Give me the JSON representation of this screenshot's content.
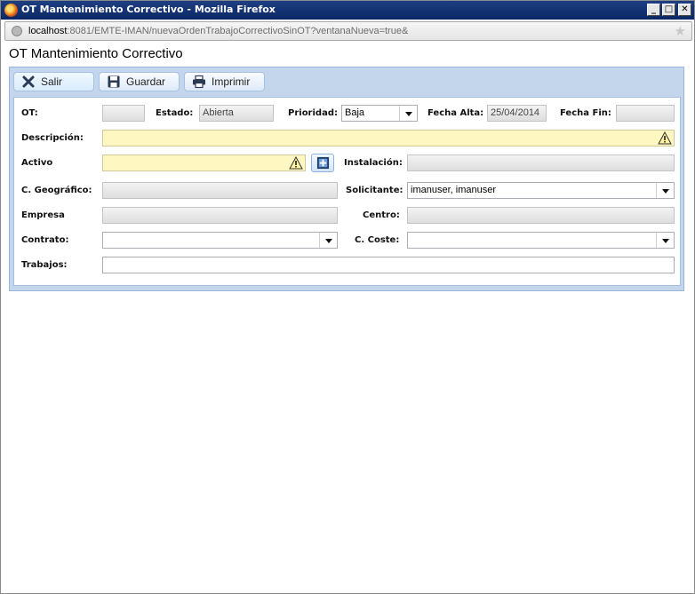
{
  "window": {
    "title": "OT Mantenimiento Correctivo - Mozilla Firefox",
    "buttons": {
      "minimize": "_",
      "maximize": "□",
      "close": "✕"
    }
  },
  "address": {
    "host": "localhost",
    "rest": ":8081/EMTE-IMAN/nuevaOrdenTrabajoCorrectivoSinOT?ventanaNueva=true&"
  },
  "page": {
    "title": "OT Mantenimiento Correctivo"
  },
  "toolbar": {
    "salir": "Salir",
    "guardar": "Guardar",
    "imprimir": "Imprimir"
  },
  "form": {
    "ot": {
      "label": "OT:",
      "value": ""
    },
    "estado": {
      "label": "Estado:",
      "value": "Abierta"
    },
    "prioridad": {
      "label": "Prioridad:",
      "value": "Baja"
    },
    "fecha_alta": {
      "label": "Fecha Alta:",
      "value": "25/04/2014"
    },
    "fecha_fin": {
      "label": "Fecha Fin:",
      "value": ""
    },
    "descripcion": {
      "label": "Descripción:",
      "value": ""
    },
    "activo": {
      "label": "Activo",
      "value": ""
    },
    "instalacion": {
      "label": "Instalación:",
      "value": ""
    },
    "c_geografico": {
      "label": "C. Geográfico:",
      "value": ""
    },
    "solicitante": {
      "label": "Solicitante:",
      "value": "imanuser, imanuser"
    },
    "empresa": {
      "label": "Empresa",
      "value": ""
    },
    "centro": {
      "label": "Centro:",
      "value": ""
    },
    "contrato": {
      "label": "Contrato:",
      "value": ""
    },
    "c_coste": {
      "label": "C. Coste:",
      "value": ""
    },
    "trabajos": {
      "label": "Trabajos:",
      "value": ""
    }
  },
  "icons": {
    "salir": "close-x-icon",
    "guardar": "floppy-disk-icon",
    "imprimir": "printer-icon",
    "warning": "warning-triangle-icon",
    "add": "add-item-icon",
    "bookmark": "star-icon",
    "site": "globe-icon",
    "browser": "firefox-icon"
  },
  "colors": {
    "titlebar": "#0b2765",
    "panel": "#c4d6ec",
    "required_field": "#fff7c1",
    "readonly_field": "#e6e6e6"
  }
}
